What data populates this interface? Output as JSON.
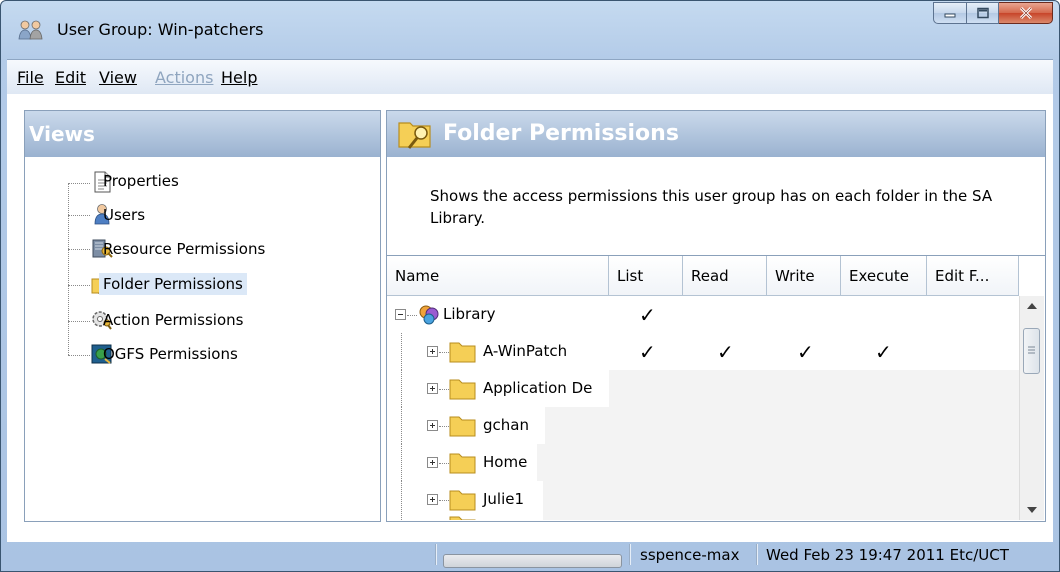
{
  "window": {
    "title": "User Group: Win-patchers",
    "caption_buttons": [
      "minimize",
      "maximize",
      "close"
    ]
  },
  "menu": {
    "items": [
      {
        "label": "File",
        "enabled": true
      },
      {
        "label": "Edit",
        "enabled": true
      },
      {
        "label": "View",
        "enabled": true
      },
      {
        "label": "Actions",
        "enabled": false
      },
      {
        "label": "Help",
        "enabled": true
      }
    ]
  },
  "views": {
    "title": "Views",
    "items": [
      {
        "label": "Properties",
        "icon": "document-icon"
      },
      {
        "label": "Users",
        "icon": "user-icon"
      },
      {
        "label": "Resource Permissions",
        "icon": "server-key-icon"
      },
      {
        "label": "Folder Permissions",
        "icon": "folder-key-icon",
        "selected": true
      },
      {
        "label": "Action Permissions",
        "icon": "gear-key-icon"
      },
      {
        "label": "OGFS Permissions",
        "icon": "terminal-icon"
      }
    ]
  },
  "panel": {
    "title": "Folder Permissions",
    "description": "Shows the access permissions this user group has on each folder in the SA Library."
  },
  "table": {
    "columns": [
      "Name",
      "List",
      "Read",
      "Write",
      "Execute",
      "Edit F..."
    ],
    "rows": [
      {
        "name": "Library",
        "list": "✓",
        "read": "",
        "write": "",
        "execute": "",
        "edit": ""
      },
      {
        "name": "A-WinPatch",
        "list": "✓",
        "read": "✓",
        "write": "✓",
        "execute": "✓",
        "edit": ""
      },
      {
        "name": "Application De",
        "list": "",
        "read": "",
        "write": "",
        "execute": "",
        "edit": ""
      },
      {
        "name": "gchan",
        "list": "",
        "read": "",
        "write": "",
        "execute": "",
        "edit": ""
      },
      {
        "name": "Home",
        "list": "",
        "read": "",
        "write": "",
        "execute": "",
        "edit": ""
      },
      {
        "name": "Julie1",
        "list": "",
        "read": "",
        "write": "",
        "execute": "",
        "edit": ""
      }
    ]
  },
  "status": {
    "user": "sspence-max",
    "datetime": "Wed Feb 23 19:47 2011 Etc/UCT"
  },
  "colors": {
    "header_gradient_top": "#cad9eb",
    "header_gradient_bottom": "#9ab2d0",
    "selected_bg": "#dbe8f7",
    "folder": "#f5cf56"
  }
}
